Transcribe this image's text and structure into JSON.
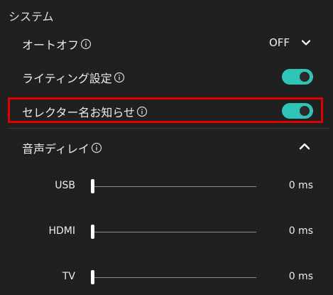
{
  "section": {
    "title": "システム"
  },
  "auto_off": {
    "label": "オートオフ",
    "value": "OFF"
  },
  "lighting": {
    "label": "ライティング設定",
    "state": "on"
  },
  "selector_notice": {
    "label": "セレクター名お知らせ",
    "state": "on"
  },
  "audio_delay": {
    "label": "音声ディレイ",
    "expanded": true,
    "items": [
      {
        "label": "USB",
        "value": "0 ms",
        "level": 0
      },
      {
        "label": "HDMI",
        "value": "0 ms",
        "level": 0
      },
      {
        "label": "TV",
        "value": "0 ms",
        "level": 0
      }
    ]
  },
  "colors": {
    "background": "#202020",
    "toggle_on": "#2ec4b6",
    "highlight": "#e00000"
  },
  "icons": {
    "info": "info-icon",
    "dropdown": "chevron-down-icon",
    "collapse": "chevron-up-icon"
  }
}
